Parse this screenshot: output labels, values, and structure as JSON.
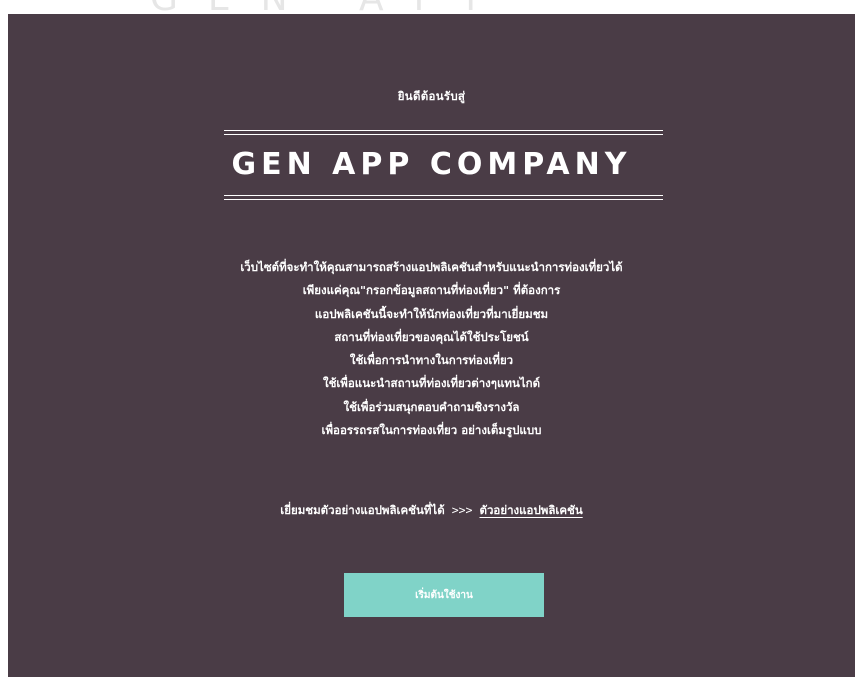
{
  "header": {
    "welcome": "ยินดีต้อนรับสู่",
    "company_name": "GEN APP COMPANY"
  },
  "description": {
    "lines": [
      "เว็บไซต์ที่จะทำให้คุณสามารถสร้างแอปพลิเคชันสำหรับแนะนำการท่องเที่ยวได้",
      "เพียงแค่คุณ\"กรอกข้อมูลสถานที่ท่องเที่ยว\" ที่ต้องการ",
      "แอปพลิเคชันนี้จะทำให้นักท่องเที่ยวที่มาเยี่ยมชม",
      "สถานที่ท่องเที่ยวของคุณได้ใช้ประโยชน์",
      "ใช้เพื่อการนำทางในการท่องเที่ยว",
      "ใช้เพื่อแนะนำสถานที่ท่องเที่ยวต่างๆแทนไกด์",
      "ใช้เพื่อร่วมสนุกตอบคำถามชิงรางวัล",
      "เพื่ออรรถรสในการท่องเที่ยว อย่างเต็มรูปแบบ"
    ]
  },
  "example": {
    "prefix": "เยี่ยมชมตัวอย่างแอปพลิเคชันที่ได้",
    "arrows": ">>>",
    "link_label": "ตัวอย่างแอปพลิเคชัน"
  },
  "actions": {
    "start_label": "เริ่มต้นใช้งาน"
  },
  "colors": {
    "panel_background": "#4a3c46",
    "button_background": "#80d3c8",
    "text": "#ffffff"
  }
}
